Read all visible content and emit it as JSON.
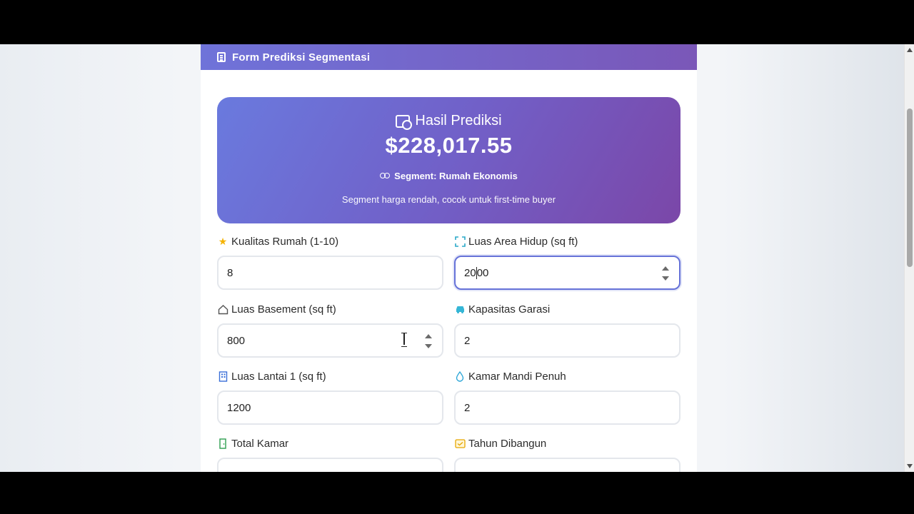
{
  "header": {
    "title": "Form Prediksi Segmentasi",
    "icon": "calculator-icon"
  },
  "result": {
    "title": "Hasil Prediksi",
    "icon": "money-icon",
    "value": "$228,017.55",
    "segment_icon": "users-icon",
    "segment": "Segment: Rumah Ekonomis",
    "description": "Segment harga rendah, cocok untuk first-time buyer"
  },
  "fields": {
    "quality": {
      "label": "Kualitas Rumah (1-10)",
      "icon": "star-icon",
      "value": "8",
      "color": "#f5b301"
    },
    "living_area": {
      "label": "Luas Area Hidup (sq ft)",
      "icon": "expand-icon",
      "value_before_caret": "20",
      "value_after_caret": "00",
      "color": "#2aa9c9"
    },
    "basement": {
      "label": "Luas Basement (sq ft)",
      "icon": "house-icon",
      "value": "800",
      "color": "#555555"
    },
    "garage": {
      "label": "Kapasitas Garasi",
      "icon": "car-icon",
      "value": "2",
      "color": "#35b6d6"
    },
    "first_floor": {
      "label": "Luas Lantai 1 (sq ft)",
      "icon": "building-icon",
      "value": "1200",
      "color": "#3a6fd8"
    },
    "bathrooms": {
      "label": "Kamar Mandi Penuh",
      "icon": "droplet-icon",
      "value": "2",
      "color": "#2ea7d8"
    },
    "total_rooms": {
      "label": "Total Kamar",
      "icon": "door-icon",
      "value": "",
      "color": "#2e9e4f"
    },
    "year_built": {
      "label": "Tahun Dibangun",
      "icon": "calendar-icon",
      "value": "",
      "color": "#e6a700"
    }
  }
}
